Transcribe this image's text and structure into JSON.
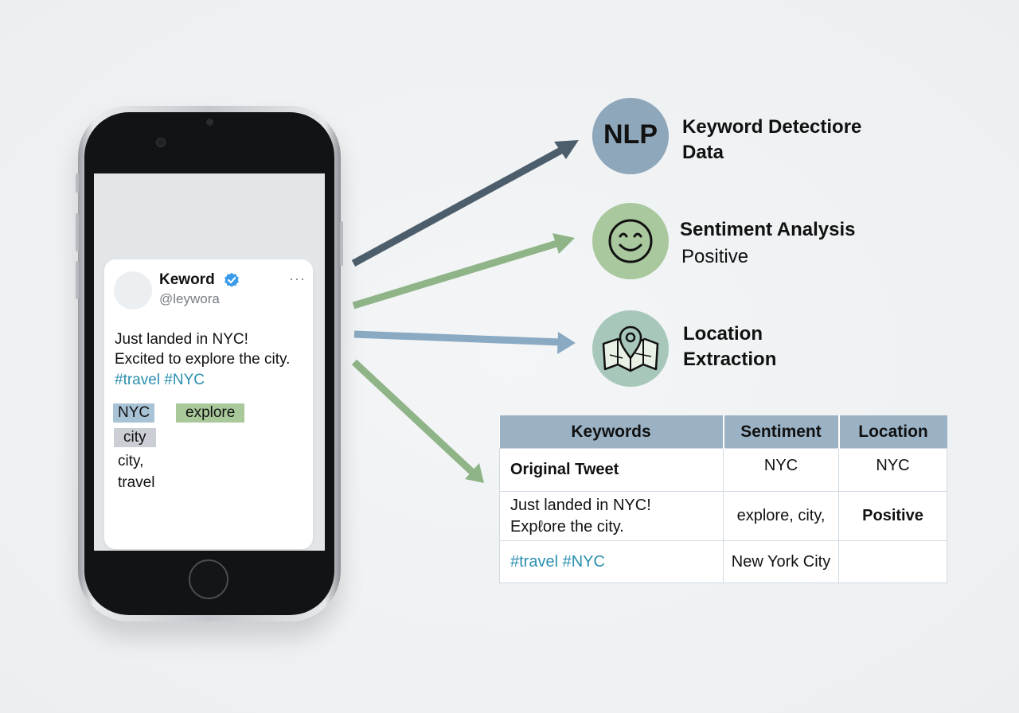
{
  "tweet": {
    "name": "Keword",
    "handle": "@leywora",
    "more": "···",
    "line1": "Just landed in NYC!",
    "line2": "Excited to explore the city.",
    "hashtags": "#travel #NYC",
    "chips": [
      "NYC",
      "explore",
      "city"
    ],
    "plain": [
      "city,",
      "travel"
    ]
  },
  "outputs": {
    "nlp": {
      "icon_text": "NLP",
      "label_line1": "Keyword Detectiore",
      "label_line2": "Data"
    },
    "sentiment": {
      "icon": "smiley-icon",
      "label_line1": "Sentiment Analysis",
      "label_line2": "Positive"
    },
    "location": {
      "icon": "map-pin-icon",
      "label_line1": "Location",
      "label_line2": "Extraction"
    }
  },
  "table": {
    "headers": [
      "Keywords",
      "Sentiment",
      "Location"
    ],
    "rows": [
      [
        "Original Tweet",
        "NYC",
        "NYC"
      ],
      [
        "Just landed in NYC!",
        "explore, city,",
        "Positive"
      ],
      [
        "#travel #NYC",
        "New York City",
        ""
      ]
    ],
    "row2_line2": "Expℓore the city."
  },
  "colors": {
    "arrow_dark": "#4c5e6b",
    "arrow_green": "#8fb487",
    "arrow_blue": "#8aa9c2",
    "hashtag": "#2b8fb0",
    "verified": "#3a9be8"
  }
}
